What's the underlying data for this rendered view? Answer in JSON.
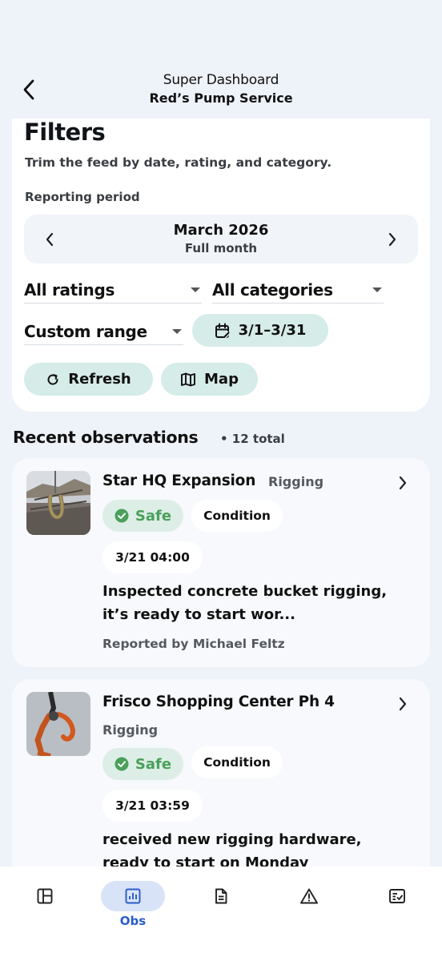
{
  "header": {
    "title": "Super Dashboard",
    "subtitle": "Red’s Pump Service"
  },
  "filters": {
    "title": "Filters",
    "description": "Trim the feed by date, rating, and category.",
    "period_label": "Reporting period",
    "period_month": "March 2026",
    "period_sub": "Full month",
    "ratings_select": "All ratings",
    "categories_select": "All categories",
    "range_select": "Custom range",
    "date_range": "3/1–3/31",
    "refresh_label": "Refresh",
    "map_label": "Map"
  },
  "observations": {
    "section_title": "Recent observations",
    "count_text": "• 12 total",
    "items": [
      {
        "project": "Star HQ Expansion",
        "category": "Rigging",
        "rating": "Safe",
        "type": "Condition",
        "timestamp": "3/21 04:00",
        "description": "Inspected concrete bucket rigging, it’s ready to start wor...",
        "reporter": "Reported by Michael Feltz"
      },
      {
        "project": "Frisco Shopping Center Ph 4",
        "category": "Rigging",
        "rating": "Safe",
        "type": "Condition",
        "timestamp": "3/21 03:59",
        "description": "received new rigging hardware, ready to start on Monday"
      }
    ]
  },
  "tabbar": {
    "active_label": "Obs"
  },
  "colors": {
    "accent_teal": "#d5ece8",
    "safe_green": "#4aa05a",
    "active_blue": "#2a5cc9"
  }
}
